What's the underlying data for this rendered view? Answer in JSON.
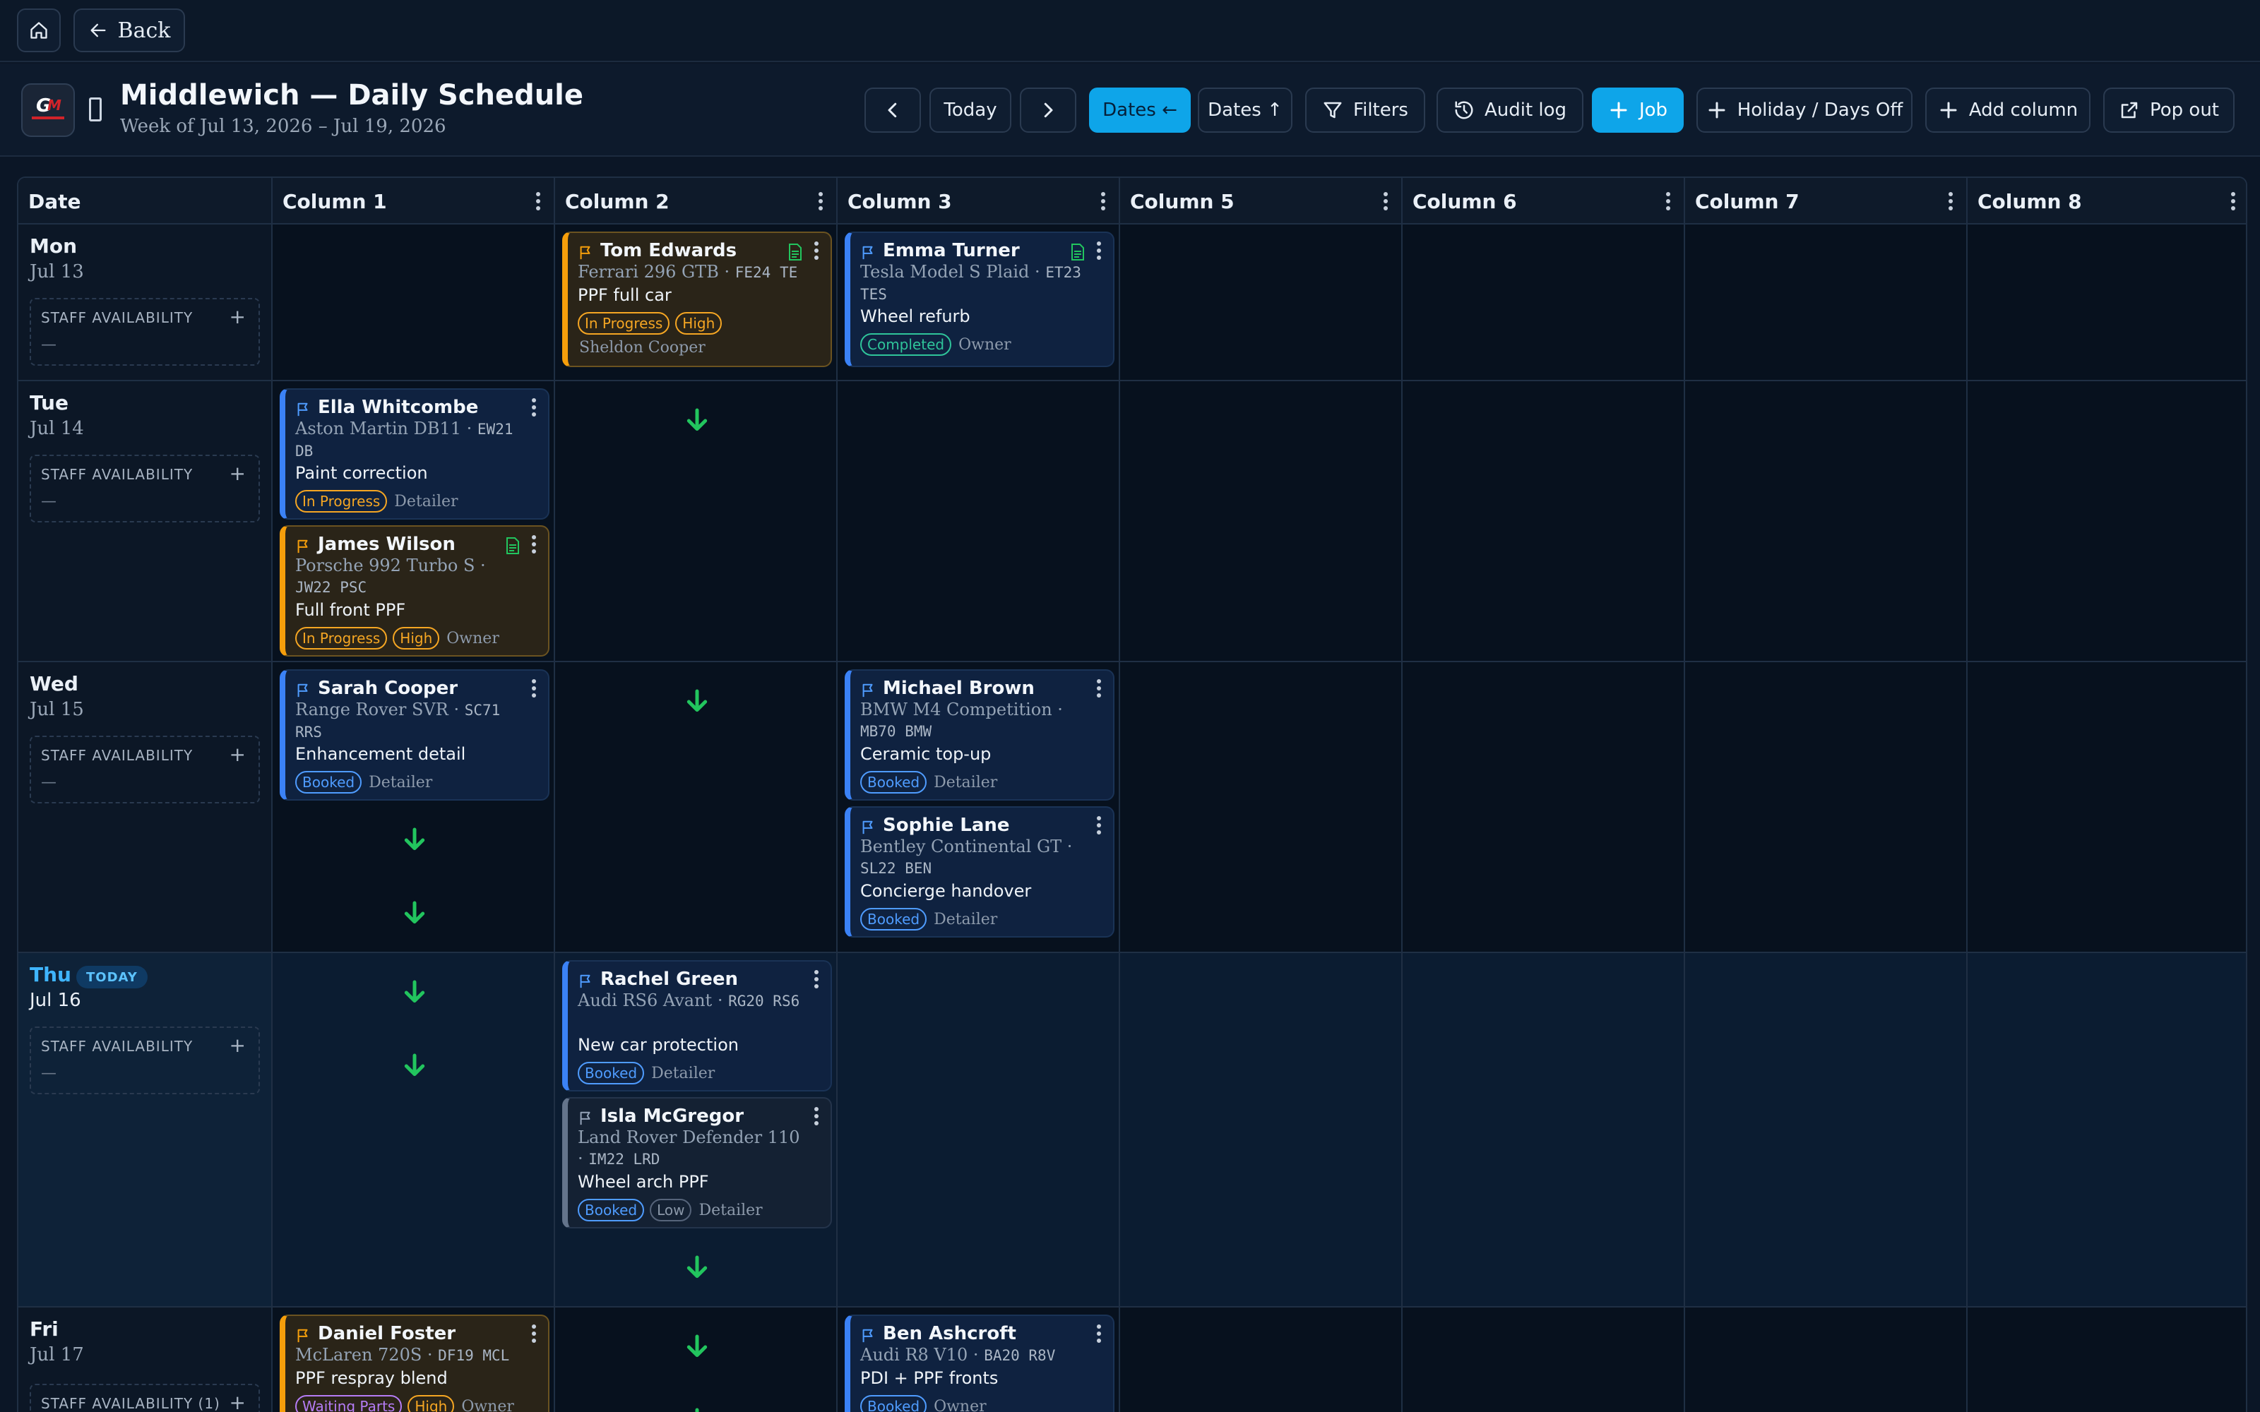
{
  "nav": {
    "home_icon": "home-icon",
    "back_label": "Back"
  },
  "header": {
    "title": "Middlewich — Daily Schedule",
    "subtitle": "Week of Jul 13, 2026 – Jul 19, 2026"
  },
  "toolbar": {
    "today_label": "Today",
    "dates_horizontal_label": "Dates ←",
    "dates_vertical_label": "Dates ↑",
    "filters_label": "Filters",
    "audit_label": "Audit log",
    "job_label": "Job",
    "holiday_label": "Holiday / Days Off",
    "add_column_label": "Add column",
    "popout_label": "Pop out"
  },
  "grid": {
    "date_header": "Date",
    "columns": [
      "Column 1",
      "Column 2",
      "Column 3",
      "Column 5",
      "Column 6",
      "Column 7",
      "Column 8"
    ]
  },
  "days": [
    {
      "name": "Mon",
      "date": "Jul 13",
      "staff_label": "STAFF AVAILABILITY",
      "staff_value": "—"
    },
    {
      "name": "Tue",
      "date": "Jul 14",
      "staff_label": "STAFF AVAILABILITY",
      "staff_value": "—"
    },
    {
      "name": "Wed",
      "date": "Jul 15",
      "staff_label": "STAFF AVAILABILITY",
      "staff_value": "—"
    },
    {
      "name": "Thu",
      "date": "Jul 16",
      "staff_label": "STAFF AVAILABILITY",
      "staff_value": "—",
      "badge": "TODAY"
    },
    {
      "name": "Fri",
      "date": "Jul 17",
      "staff_label": "STAFF AVAILABILITY (1)",
      "staff_value": ""
    }
  ],
  "jobs": {
    "tom": {
      "customer": "Tom Edwards",
      "vehicle": "Ferrari 296 GTB ·",
      "reg": "FE24 TE",
      "service": "PPF full car",
      "status": "In Progress",
      "priority": "High",
      "assignee": "Sheldon Cooper"
    },
    "emma": {
      "customer": "Emma Turner",
      "vehicle": "Tesla Model S Plaid ·",
      "reg": "ET23 TES",
      "service": "Wheel refurb",
      "status": "Completed",
      "assignee": "Owner"
    },
    "ella": {
      "customer": "Ella Whitcombe",
      "vehicle": "Aston Martin DB11 ·",
      "reg": "EW21 DB",
      "service": "Paint correction",
      "status": "In Progress",
      "assignee": "Detailer"
    },
    "james": {
      "customer": "James Wilson",
      "vehicle": "Porsche 992 Turbo S ·",
      "reg": "JW22 PSC",
      "service": "Full front PPF",
      "status": "In Progress",
      "priority": "High",
      "assignee": "Owner"
    },
    "sarah": {
      "customer": "Sarah Cooper",
      "vehicle": "Range Rover SVR ·",
      "reg": "SC71 RRS",
      "service": "Enhancement detail",
      "status": "Booked",
      "assignee": "Detailer"
    },
    "michael": {
      "customer": "Michael Brown",
      "vehicle": "BMW M4 Competition ·",
      "reg": "MB70 BMW",
      "service": "Ceramic top-up",
      "status": "Booked",
      "assignee": "Detailer"
    },
    "sophie": {
      "customer": "Sophie Lane",
      "vehicle": "Bentley Continental GT ·",
      "reg": "SL22 BEN",
      "service": "Concierge handover",
      "status": "Booked",
      "assignee": "Detailer"
    },
    "rachel": {
      "customer": "Rachel Green",
      "vehicle": "Audi RS6 Avant ·",
      "reg": "RG20 RS6",
      "service": "New car protection",
      "status": "Booked",
      "assignee": "Detailer"
    },
    "isla": {
      "customer": "Isla McGregor",
      "vehicle": "Land Rover Defender 110 ·",
      "reg": "IM22 LRD",
      "service": "Wheel arch PPF",
      "status": "Booked",
      "priority": "Low",
      "assignee": "Detailer"
    },
    "daniel": {
      "customer": "Daniel Foster",
      "vehicle": "McLaren 720S ·",
      "reg": "DF19 MCL",
      "service": "PPF respray blend",
      "status": "Waiting Parts",
      "priority": "High",
      "assignee": "Owner"
    },
    "ben": {
      "customer": "Ben Ashcroft",
      "vehicle": "Audi R8 V10 ·",
      "reg": "BA20 R8V",
      "service": "PDI + PPF fronts",
      "status": "Booked",
      "assignee": "Owner"
    }
  },
  "colors": {
    "accent": "#0ea5e9",
    "card_blue": "#3b82f6",
    "card_amber": "#f59e0b",
    "status_in_progress": "#f5a623",
    "status_booked": "#4f9cff",
    "status_completed": "#2fc49a",
    "status_waiting": "#b57cf5",
    "arrow": "#22c55e"
  }
}
